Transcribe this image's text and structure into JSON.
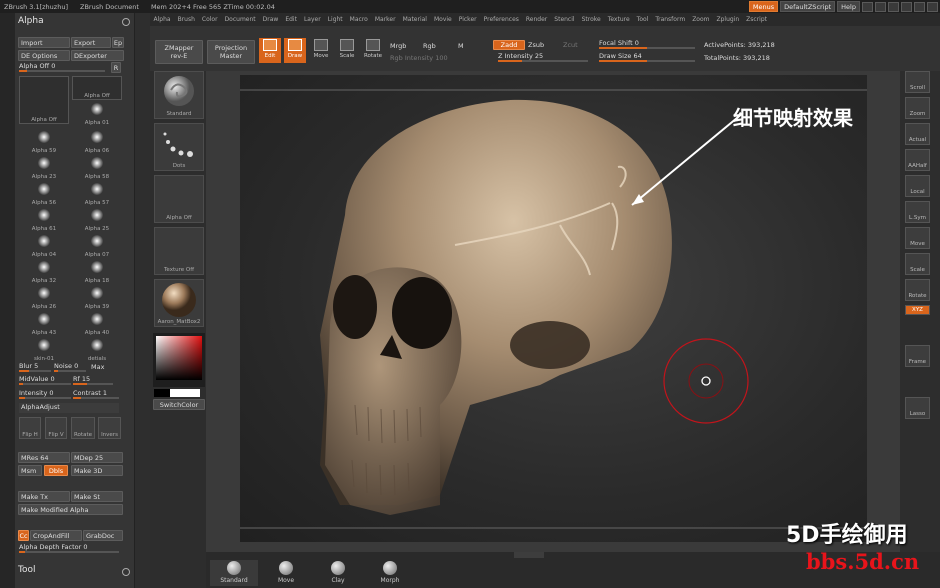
{
  "title_bar": {
    "items": [
      "ZBrush 3.1[zhuzhu]",
      "ZBrush Document",
      "Mem 202+4 Free 565 ZTime 00:02.04"
    ],
    "menus_btn": "Menus",
    "script_btn": "DefaultZScript",
    "help_btn": "Help"
  },
  "top_menu": [
    "Alpha",
    "Brush",
    "Color",
    "Document",
    "Draw",
    "Edit",
    "Layer",
    "Light",
    "Macro",
    "Marker",
    "Material",
    "Movie",
    "Picker",
    "Preferences",
    "Render",
    "Stencil",
    "Stroke",
    "Texture",
    "Tool",
    "Transform",
    "Zoom",
    "Zplugin",
    "Zscript"
  ],
  "alpha_panel": {
    "title": "Alpha",
    "import": "Import",
    "export": "Export",
    "ep": "Ep",
    "de_options": "DE Options",
    "dexporter": "DExporter",
    "alpha_off": "Alpha Off",
    "alpha_off_value": "0",
    "r_btn": "R",
    "tile_big_label": "Alpha Off",
    "tile_small_label": "Alpha Off",
    "grid": [
      "Alpha 01",
      "Alpha 59",
      "Alpha 06",
      "Alpha 23",
      "Alpha 58",
      "Alpha 56",
      "Alpha 57",
      "Alpha 61",
      "Alpha 25",
      "Alpha 04",
      "Alpha 07",
      "Alpha 32",
      "Alpha 18",
      "Alpha 26",
      "Alpha 39",
      "Alpha 43",
      "Alpha 40",
      "skin-01",
      "detials"
    ],
    "blur_label": "Blur",
    "blur_value": "5",
    "noise_label": "Noise",
    "noise_value": "0",
    "max": "Max",
    "midvalue_label": "MidValue",
    "midvalue_value": "0",
    "rf_label": "Rf",
    "rf_value": "15",
    "intensity_label": "Intensity",
    "intensity_value": "0",
    "contrast_label": "Contrast",
    "contrast_value": "1",
    "alpha_adjust": "AlphaAdjust",
    "flip_h": "Flip H",
    "flip_v": "Flip V",
    "rotate": "Rotate",
    "invers": "Invers",
    "mres_label": "MRes",
    "mres_value": "64",
    "mdep_label": "MDep",
    "mdep_value": "25",
    "msm": "Msm",
    "dbls": "Dbls",
    "make_3d": "Make 3D",
    "make_tx": "Make Tx",
    "make_st": "Make St",
    "make_modified_alpha": "Make Modified Alpha",
    "cc": "Cc",
    "crop_and_fill": "CropAndFill",
    "grab_doc": "GrabDoc",
    "alpha_depth_factor_label": "Alpha Depth Factor",
    "alpha_depth_factor_value": "0",
    "tool_title": "Tool"
  },
  "toolbar": {
    "zmapper": "ZMapper",
    "zmapper_sub": "rev-E",
    "projection": "Projection",
    "projection_sub": "Master",
    "edit": "Edit",
    "draw": "Draw",
    "move": "Move",
    "scale": "Scale",
    "rotate": "Rotate",
    "mrgb": "Mrgb",
    "rgb": "Rgb",
    "m": "M",
    "rgb_intensity_label": "Rgb Intensity",
    "rgb_intensity_value": "100",
    "zadd": "Zadd",
    "zsub": "Zsub",
    "zcut": "Zcut",
    "z_intensity_label": "Z Intensity",
    "z_intensity_value": "25",
    "focal_shift_label": "Focal Shift",
    "focal_shift_value": "0",
    "draw_size_label": "Draw Size",
    "draw_size_value": "64",
    "active_points_label": "ActivePoints:",
    "active_points_value": "393,218",
    "total_points_label": "TotalPoints:",
    "total_points_value": "393,218"
  },
  "shelf": {
    "tiles": [
      "Standard",
      "Dots",
      "Alpha Off",
      "Texture Off",
      "Aaron_MatBox2"
    ],
    "switch_color": "SwitchColor"
  },
  "right_panel": [
    "Scroll",
    "Zoom",
    "Actual",
    "AAHalf",
    "Local",
    "L.Sym",
    "Move",
    "Scale",
    "Rotate",
    "XYZ",
    "Frame",
    "Lasso"
  ],
  "bottom_bar": [
    "Standard",
    "Move",
    "Clay",
    "Morph"
  ],
  "annotation": "细节映射效果",
  "watermark_line1": "5D手绘御用",
  "watermark_line2": "bbs.5d.cn",
  "colors": {
    "accent": "#d9651c",
    "panel": "#353535",
    "canvas": "#2a2a2a"
  }
}
